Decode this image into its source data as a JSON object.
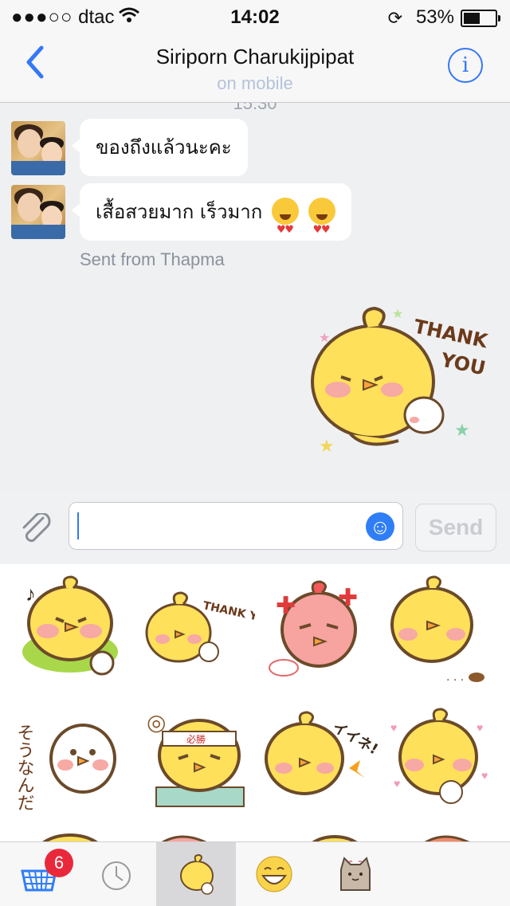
{
  "status_bar": {
    "carrier": "dtac",
    "signal_dots": "●●●○○",
    "time": "14:02",
    "battery_percent": "53%",
    "battery_level": 0.53
  },
  "nav": {
    "title": "Siriporn Charukijpipat",
    "subtitle": "on mobile",
    "back_icon": "chevron-left",
    "info_icon": "info-circle",
    "info_glyph": "i",
    "accent_color": "#3478f6"
  },
  "chat": {
    "partial_timestamp": "15:30",
    "messages": [
      {
        "text": "ของถึงแล้วนะคะ",
        "emoji_count": 0
      },
      {
        "text": "เสื้อสวยมาก เร็วมาก",
        "emoji_count": 2
      }
    ],
    "sent_from": "Sent from Thapma",
    "sticker_text": "THANK YOU"
  },
  "input": {
    "placeholder": "",
    "send_label": "Send"
  },
  "sticker_grid": {
    "labels": [
      "THANK YOU",
      "そうなんだぁ",
      "イイネ!",
      "必勝"
    ]
  },
  "tab_bar": {
    "store_badge": "6",
    "tabs": [
      "store-basket-icon",
      "recent-clock-icon",
      "chick-sticker-pack-icon",
      "grin-emoji-pack-icon",
      "cat-sticker-pack-icon"
    ]
  }
}
